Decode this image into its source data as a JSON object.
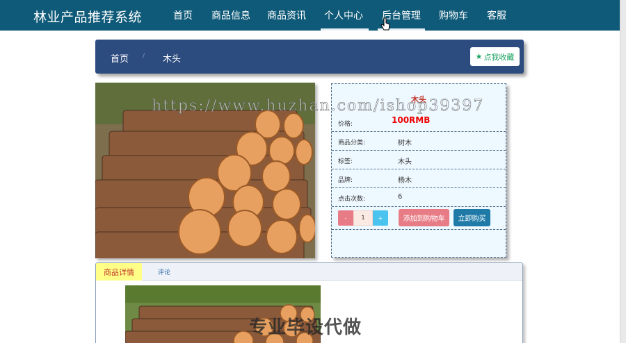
{
  "navbar": {
    "brand": "林业产品推荐系统",
    "items": [
      "首页",
      "商品信息",
      "商品资讯",
      "个人中心",
      "后台管理",
      "购物车",
      "客服"
    ]
  },
  "breadcrumb": {
    "home": "首页",
    "separator": "/",
    "current": "木头"
  },
  "favorite_button": "点我收藏",
  "product": {
    "name": "木头",
    "rows": [
      {
        "label": "价格:",
        "value": "100RMB"
      },
      {
        "label": "商品分类:",
        "value": "树木"
      },
      {
        "label": "标签:",
        "value": "木头"
      },
      {
        "label": "品牌:",
        "value": "杨木"
      },
      {
        "label": "点击次数:",
        "value": "6"
      }
    ],
    "quantity": "1",
    "minus_label": "-",
    "plus_label": "+",
    "add_to_cart": "添加到购物车",
    "buy_now": "立即购买"
  },
  "tabs": [
    "商品详情",
    "评论"
  ],
  "watermark": "https://www.huzhan.com/ishop39397",
  "overlay_text": "专业毕设代做",
  "colors": {
    "navbar": "#0e5a78",
    "breadcrumb": "#2c4b7e",
    "price": "#e00000",
    "accent_green": "#1aa260"
  }
}
